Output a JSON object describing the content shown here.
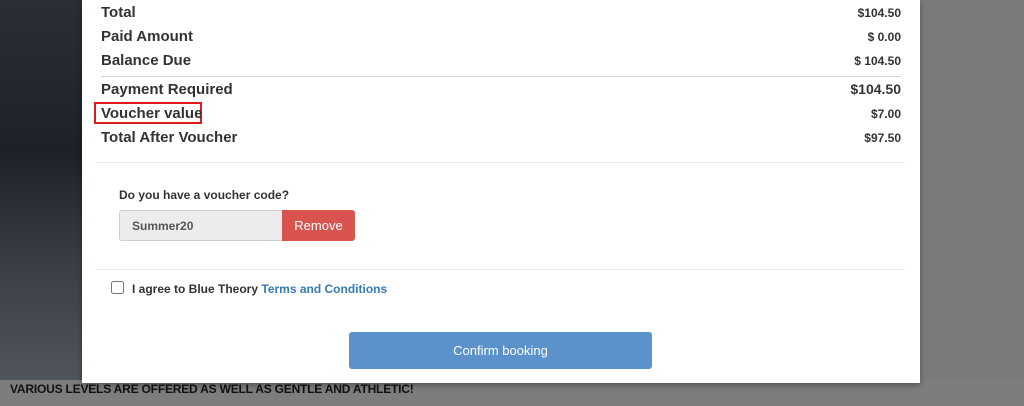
{
  "background": {
    "caption": "VARIOUS LEVELS ARE OFFERED AS WELL AS GENTLE AND ATHLETIC!"
  },
  "summary": {
    "total": {
      "label": "Total",
      "value": "$104.50"
    },
    "paid": {
      "label": "Paid Amount",
      "value": "$ 0.00"
    },
    "balance": {
      "label": "Balance Due",
      "value": "$ 104.50"
    },
    "payment_required": {
      "label": "Payment Required",
      "value": "$104.50"
    },
    "voucher_value": {
      "label": "Voucher value",
      "value": "$7.00"
    },
    "total_after_voucher": {
      "label": "Total After Voucher",
      "value": "$97.50"
    }
  },
  "voucher": {
    "question": "Do you have a voucher code?",
    "code": "Summer20",
    "remove_label": "Remove"
  },
  "terms": {
    "agree_text": "I agree to Blue Theory",
    "link_text": "Terms and Conditions",
    "checked": false
  },
  "confirm_label": "Confirm booking",
  "colors": {
    "highlight": "#e0191c",
    "remove": "#d9534f",
    "confirm": "#5b92cb",
    "link": "#337ab7"
  }
}
